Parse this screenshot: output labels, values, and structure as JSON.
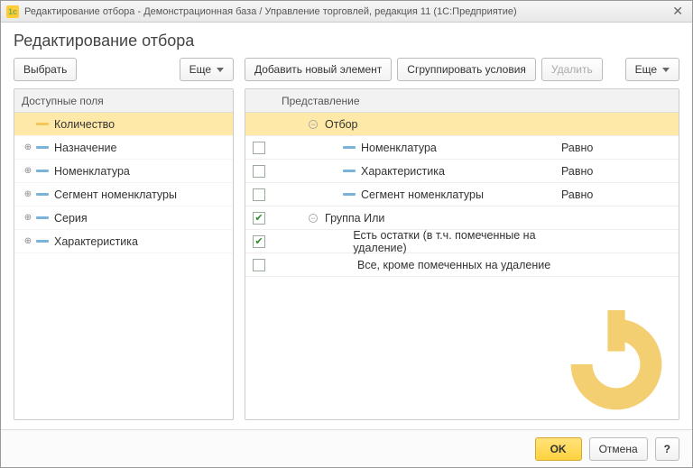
{
  "titlebar": {
    "text": "Редактирование отбора - Демонстрационная база / Управление торговлей, редакция 11 (1С:Предприятие)"
  },
  "header": {
    "title": "Редактирование отбора"
  },
  "toolbar": {
    "select": "Выбрать",
    "more_left": "Еще",
    "add_element": "Добавить новый элемент",
    "group_conditions": "Сгруппировать условия",
    "delete": "Удалить",
    "more_right": "Еще"
  },
  "left_panel": {
    "header": "Доступные поля",
    "items": [
      {
        "label": "Количество",
        "expandable": false,
        "selected": true
      },
      {
        "label": "Назначение",
        "expandable": true
      },
      {
        "label": "Номенклатура",
        "expandable": true
      },
      {
        "label": "Сегмент номенклатуры",
        "expandable": true
      },
      {
        "label": "Серия",
        "expandable": true
      },
      {
        "label": "Характеристика",
        "expandable": true
      }
    ]
  },
  "right_panel": {
    "header": "Представление",
    "rows": [
      {
        "type": "root",
        "label": "Отбор",
        "selected": true
      },
      {
        "type": "item",
        "indent": 1,
        "checked": false,
        "label": "Номенклатура",
        "comparison": "Равно"
      },
      {
        "type": "item",
        "indent": 1,
        "checked": false,
        "label": "Характеристика",
        "comparison": "Равно"
      },
      {
        "type": "item",
        "indent": 1,
        "checked": false,
        "label": "Сегмент номенклатуры",
        "comparison": "Равно"
      },
      {
        "type": "group",
        "indent": 0,
        "checked": true,
        "label": "Группа Или"
      },
      {
        "type": "leaf",
        "indent": 2,
        "checked": true,
        "label": "Есть остатки (в т.ч. помеченные на удаление)"
      },
      {
        "type": "leaf",
        "indent": 2,
        "checked": false,
        "label": "Все, кроме помеченных на удаление"
      }
    ]
  },
  "footer": {
    "ok": "OK",
    "cancel": "Отмена",
    "help": "?"
  }
}
